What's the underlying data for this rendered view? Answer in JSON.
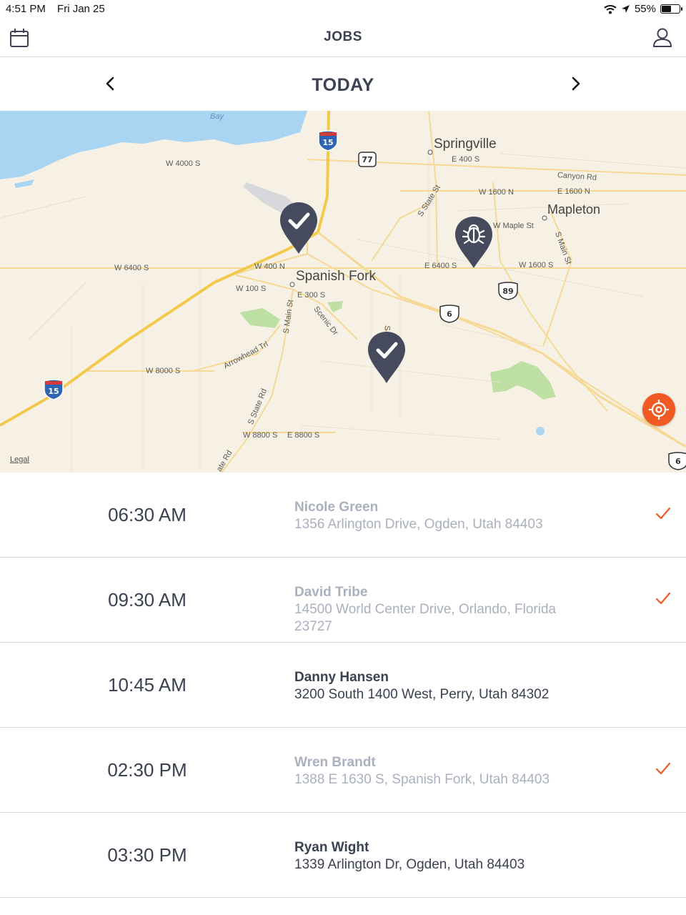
{
  "status": {
    "time": "4:51 PM",
    "date": "Fri Jan 25",
    "battery": "55%",
    "battery_level": 0.55
  },
  "nav": {
    "title": "JOBS",
    "left_icon": "calendar-icon",
    "right_icon": "user-icon"
  },
  "date_header": {
    "title": "TODAY",
    "prev_icon": "chevron-left-icon",
    "next_icon": "chevron-right-icon"
  },
  "map": {
    "legal": "Legal",
    "cities": [
      "Springville",
      "Mapleton",
      "Spanish Fork"
    ],
    "labels": [
      "Bay",
      "W 4000 S",
      "E 400 S",
      "Canyon Rd",
      "W 1600 N",
      "E 1600 N",
      "W Maple St",
      "S Main St",
      "S State St",
      "W 6400 S",
      "W 400 N",
      "E 6400 S",
      "W 1600 S",
      "W 100 S",
      "E 300 S",
      "S Main St",
      "Scenic Dr",
      "Arrowhead Trl",
      "W 8000 S",
      "S State Rd",
      "W 8800 S",
      "E 8800 S",
      "ate Rd",
      "S"
    ],
    "shields": [
      "15",
      "77",
      "89",
      "6",
      "15",
      "6"
    ],
    "pins": [
      {
        "type": "done",
        "icon": "checkmark-icon"
      },
      {
        "type": "pest",
        "icon": "bug-icon"
      },
      {
        "type": "done",
        "icon": "checkmark-icon"
      }
    ],
    "locate_icon": "crosshair-icon",
    "accent": "#f15a22",
    "pin_color": "#454a5c"
  },
  "jobs": [
    {
      "time": "06:30 AM",
      "name": "Nicole Green",
      "address": "1356 Arlington Drive, Ogden, Utah 84403",
      "status": "done"
    },
    {
      "time": "09:30 AM",
      "name": "David Tribe",
      "address": "14500 World Center Drive, Orlando, Florida 23727",
      "status": "done"
    },
    {
      "time": "10:45 AM",
      "name": "Danny Hansen",
      "address": "3200 South 1400 West, Perry, Utah 84302",
      "status": "active"
    },
    {
      "time": "02:30 PM",
      "name": "Wren Brandt",
      "address": "1388 E 1630 S, Spanish Fork, Utah 84403",
      "status": "done"
    },
    {
      "time": "03:30 PM",
      "name": "Ryan Wight",
      "address": "1339 Arlington Dr, Ogden, Utah 84403",
      "status": "active"
    }
  ],
  "colors": {
    "text": "#3b4152",
    "muted": "#aab0bd",
    "check": "#f15a22"
  }
}
